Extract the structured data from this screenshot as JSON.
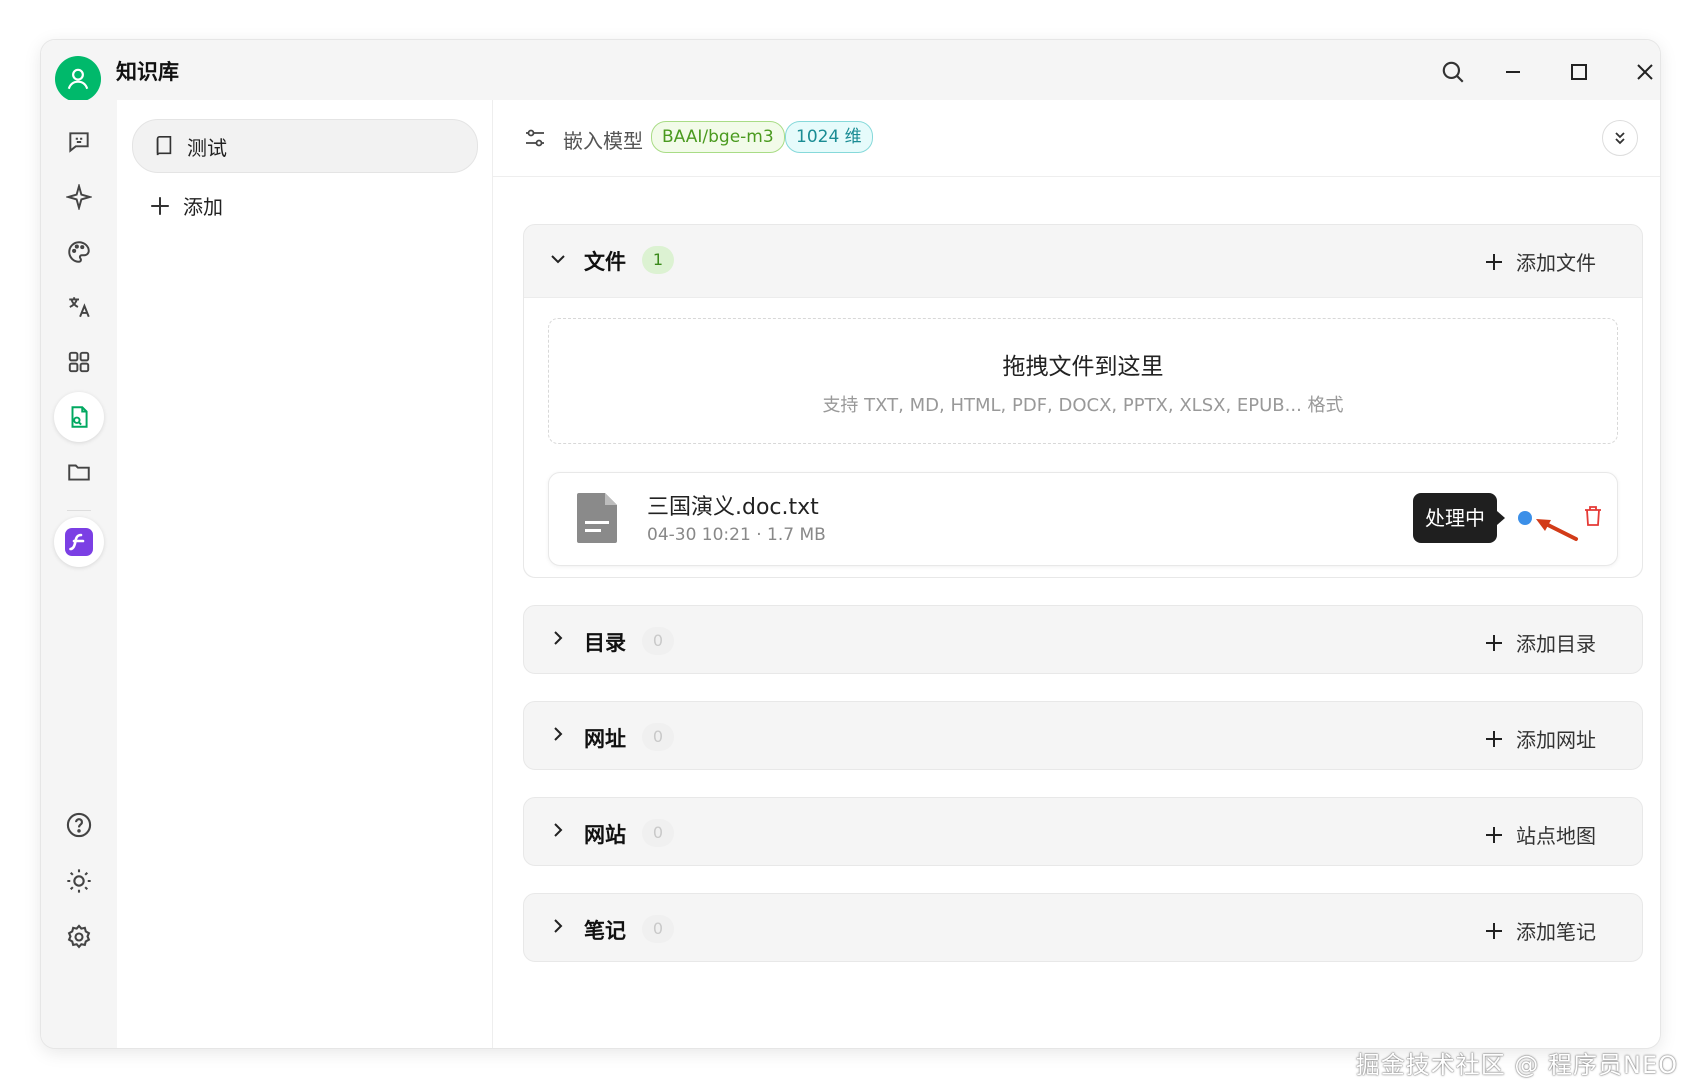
{
  "app": {
    "title": "知识库"
  },
  "knowledge_bases": {
    "items": [
      {
        "label": "测试"
      }
    ],
    "add_label": "添加"
  },
  "topbar": {
    "embed_label": "嵌入模型",
    "model_tag": "BAAI/bge-m3",
    "dim_tag": "1024 维"
  },
  "sections": {
    "files": {
      "title": "文件",
      "count": "1",
      "action": "添加文件",
      "dropzone_title": "拖拽文件到这里",
      "dropzone_hint": "支持 TXT, MD, HTML, PDF, DOCX, PPTX, XLSX, EPUB... 格式",
      "file": {
        "name": "三国演义.doc.txt",
        "meta": "04-30 10:21 · 1.7 MB",
        "status_tooltip": "处理中"
      }
    },
    "directory": {
      "title": "目录",
      "count": "0",
      "action": "添加目录"
    },
    "url": {
      "title": "网址",
      "count": "0",
      "action": "添加网址"
    },
    "website": {
      "title": "网站",
      "count": "0",
      "action": "站点地图"
    },
    "notes": {
      "title": "笔记",
      "count": "0",
      "action": "添加笔记"
    }
  },
  "colors": {
    "accent": "#00b96b",
    "status_processing": "#3b8fe8",
    "delete": "#e53935",
    "annotation_arrow": "#d23b18"
  },
  "icons": {
    "rail": [
      "chat-icon",
      "sparkle-icon",
      "palette-icon",
      "translate-icon",
      "apps-icon",
      "knowledge-icon",
      "folder-icon",
      "app-logo-icon",
      "help-icon",
      "theme-icon",
      "settings-icon"
    ]
  },
  "watermark": "掘金技术社区 @ 程序员NEO"
}
